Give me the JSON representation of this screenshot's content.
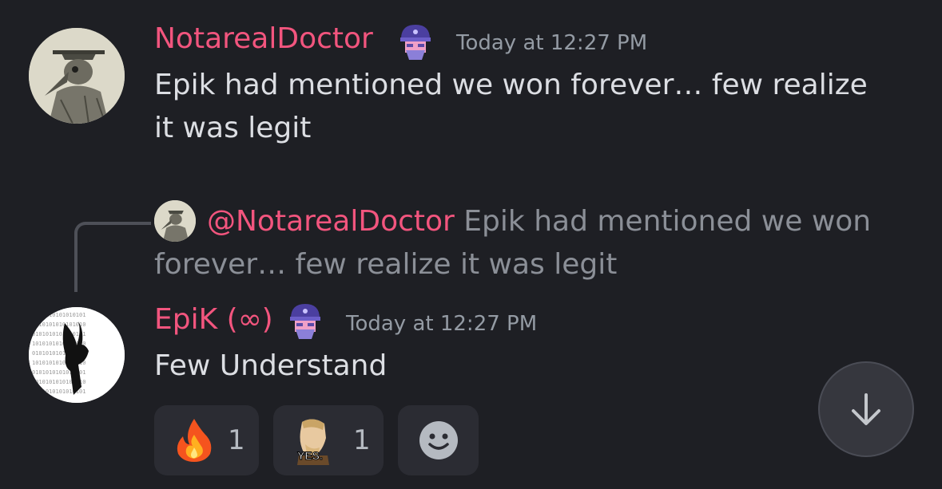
{
  "messages": [
    {
      "username": "NotarealDoctor",
      "badge_icon": "helmet-icon",
      "timestamp": "Today at 12:27 PM",
      "text": "Epik had mentioned we won forever… few realize it was legit"
    },
    {
      "reply": {
        "mention": "@NotarealDoctor",
        "text": "Epik had mentioned we won forever… few realize it was legit"
      },
      "username": "EpiK (∞)",
      "badge_icon": "helmet-icon",
      "timestamp": "Today at 12:27 PM",
      "text": "Few Understand",
      "reactions": [
        {
          "emoji": "fire-emoji",
          "count": "1"
        },
        {
          "emoji": "chad-yes-emoji",
          "count": "1",
          "emoji_label": "YES."
        },
        {
          "emoji": "add-reaction-icon"
        }
      ]
    }
  ],
  "colors": {
    "background": "#1e1f24",
    "username": "#f2557e",
    "timestamp": "#949ba4"
  },
  "scroll_button": {
    "icon": "arrow-down-icon"
  }
}
